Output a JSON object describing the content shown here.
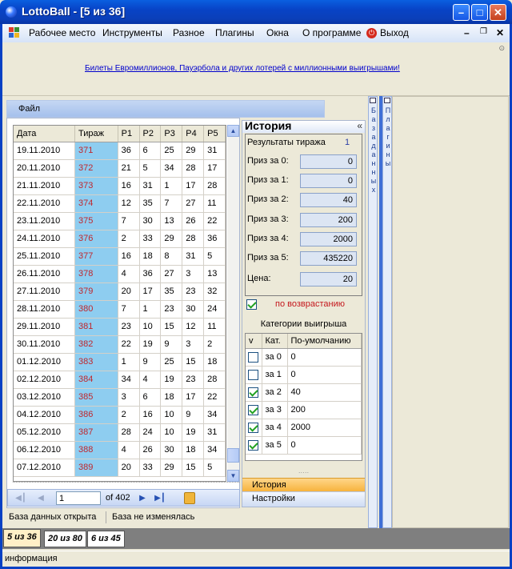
{
  "window": {
    "title": "LottoBall - [5 из 36]"
  },
  "menu": {
    "items": [
      "Рабочее место",
      "Инструменты",
      "Разное",
      "Плагины",
      "Окна",
      "О программе",
      "Выход"
    ]
  },
  "banner": {
    "link_text": "Билеты Евромиллионов, Пауэрбола и других лотерей с миллионными выигрышами!"
  },
  "file_bar": {
    "label": "Файл"
  },
  "grid": {
    "columns": [
      "Дата",
      "Тираж",
      "P1",
      "P2",
      "P3",
      "P4",
      "P5"
    ],
    "rows": [
      [
        "19.11.2010",
        "371",
        "36",
        "6",
        "25",
        "29",
        "31"
      ],
      [
        "20.11.2010",
        "372",
        "21",
        "5",
        "34",
        "28",
        "17"
      ],
      [
        "21.11.2010",
        "373",
        "16",
        "31",
        "1",
        "17",
        "28"
      ],
      [
        "22.11.2010",
        "374",
        "12",
        "35",
        "7",
        "27",
        "11"
      ],
      [
        "23.11.2010",
        "375",
        "7",
        "30",
        "13",
        "26",
        "22"
      ],
      [
        "24.11.2010",
        "376",
        "2",
        "33",
        "29",
        "28",
        "36"
      ],
      [
        "25.11.2010",
        "377",
        "16",
        "18",
        "8",
        "31",
        "5"
      ],
      [
        "26.11.2010",
        "378",
        "4",
        "36",
        "27",
        "3",
        "13"
      ],
      [
        "27.11.2010",
        "379",
        "20",
        "17",
        "35",
        "23",
        "32"
      ],
      [
        "28.11.2010",
        "380",
        "7",
        "1",
        "23",
        "30",
        "24"
      ],
      [
        "29.11.2010",
        "381",
        "23",
        "10",
        "15",
        "12",
        "11"
      ],
      [
        "30.11.2010",
        "382",
        "22",
        "19",
        "9",
        "3",
        "2"
      ],
      [
        "01.12.2010",
        "383",
        "1",
        "9",
        "25",
        "15",
        "18"
      ],
      [
        "02.12.2010",
        "384",
        "34",
        "4",
        "19",
        "23",
        "28"
      ],
      [
        "03.12.2010",
        "385",
        "3",
        "6",
        "18",
        "17",
        "22"
      ],
      [
        "04.12.2010",
        "386",
        "2",
        "16",
        "10",
        "9",
        "34"
      ],
      [
        "05.12.2010",
        "387",
        "28",
        "24",
        "10",
        "19",
        "31"
      ],
      [
        "06.12.2010",
        "388",
        "4",
        "26",
        "30",
        "18",
        "34"
      ],
      [
        "07.12.2010",
        "389",
        "20",
        "33",
        "29",
        "15",
        "5"
      ]
    ]
  },
  "navigator": {
    "position": "1",
    "of_text": "of 402"
  },
  "history": {
    "title": "История",
    "results_label": "Результаты тиража",
    "results_value": "1",
    "prizes": [
      {
        "label": "Приз за 0:",
        "value": "0"
      },
      {
        "label": "Приз за 1:",
        "value": "0"
      },
      {
        "label": "Приз за 2:",
        "value": "40"
      },
      {
        "label": "Приз за 3:",
        "value": "200"
      },
      {
        "label": "Приз за 4:",
        "value": "2000"
      },
      {
        "label": "Приз за 5:",
        "value": "435220"
      }
    ],
    "price_label": "Цена:",
    "price_value": "20",
    "ascending_label": "по возврастанию",
    "categories_title": "Категории выигрыша",
    "cat_columns": [
      "v",
      "Кат.",
      "По-умолчанию"
    ],
    "categories": [
      {
        "checked": false,
        "cat": "за 0",
        "default": "0"
      },
      {
        "checked": false,
        "cat": "за 1",
        "default": "0"
      },
      {
        "checked": true,
        "cat": "за 2",
        "default": "40"
      },
      {
        "checked": true,
        "cat": "за 3",
        "default": "200"
      },
      {
        "checked": true,
        "cat": "за 4",
        "default": "2000"
      },
      {
        "checked": true,
        "cat": "за 5",
        "default": "0"
      }
    ],
    "tab_history": "История",
    "tab_settings": "Настройки"
  },
  "side_strips": {
    "db": "База данных",
    "plugins": "Плагины"
  },
  "status": {
    "left": "База данных открыта",
    "right": "База не изменялась"
  },
  "bottom_tabs": [
    "5 из 36",
    "20 из 80",
    "6 из 45"
  ],
  "info": {
    "text": "информация"
  },
  "colors": {
    "accent": "#8ecdf0",
    "draw_text": "#c0272d",
    "title_blue": "#0843c6"
  }
}
